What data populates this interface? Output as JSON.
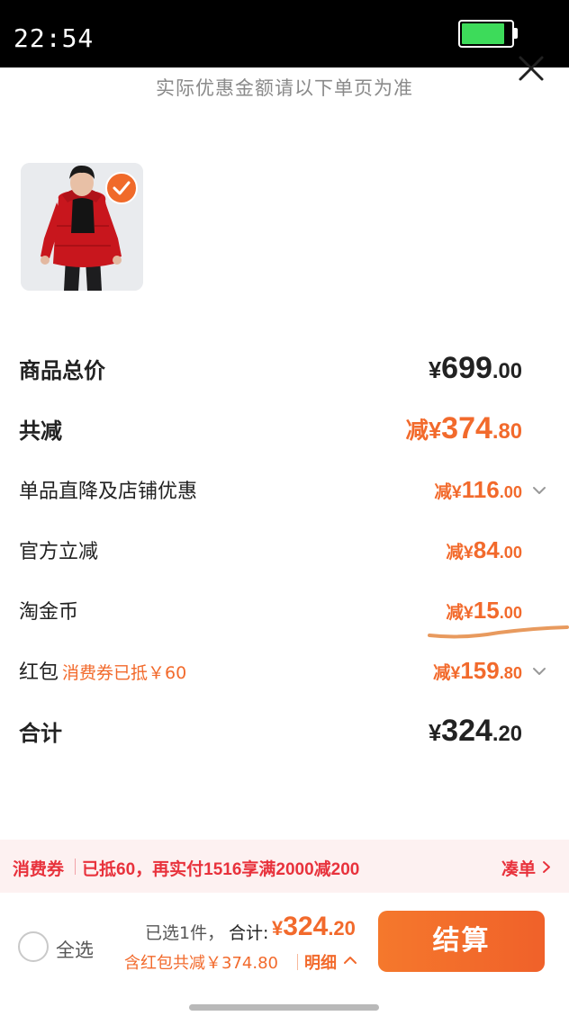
{
  "status_bar": {
    "time": "22:54",
    "battery_level": 0.87,
    "battery_color": "#3ddb5a"
  },
  "sheet": {
    "notice": "实际优惠金额请以下单页为准",
    "close_icon": "close-icon",
    "product": {
      "thumbnail_icon": "product-image-red-down-jacket",
      "selected": true
    }
  },
  "price_rows": {
    "subtotal": {
      "label": "商品总价",
      "currency": "¥",
      "integer": "699",
      "decimal": ".00"
    },
    "total_discount": {
      "label": "共减",
      "prefix": "减",
      "currency": "¥",
      "integer": "374",
      "decimal": ".80"
    },
    "store_discount": {
      "label": "单品直降及店铺优惠",
      "prefix": "减",
      "currency": "¥",
      "integer": "116",
      "decimal": ".00"
    },
    "official_discount": {
      "label": "官方立减",
      "prefix": "减",
      "currency": "¥",
      "integer": "84",
      "decimal": ".00"
    },
    "taojinbi": {
      "label": "淘金币",
      "prefix": "减",
      "currency": "¥",
      "integer": "15",
      "decimal": ".00"
    },
    "red_packet": {
      "label": "红包",
      "note": "消费券已抵￥60",
      "prefix": "减",
      "currency": "¥",
      "integer": "159",
      "decimal": ".80"
    },
    "total": {
      "label": "合计",
      "currency": "¥",
      "integer": "324",
      "decimal": ".20"
    }
  },
  "voucher_bar": {
    "tag": "消费券",
    "text": "已抵60，再实付1516享满2000减200",
    "action": "凑单"
  },
  "bottom_bar": {
    "select_all": "全选",
    "selected_count": "已选1件，",
    "total_label": "合计:",
    "total_currency": "¥",
    "total_integer": "324",
    "total_decimal": ".20",
    "discount_note": "含红包共减￥374.80",
    "detail_link": "明细",
    "checkout": "结算"
  },
  "colors": {
    "accent": "#f26a2c",
    "voucher_red": "#e8323c",
    "voucher_bg": "#fdf1f1"
  }
}
